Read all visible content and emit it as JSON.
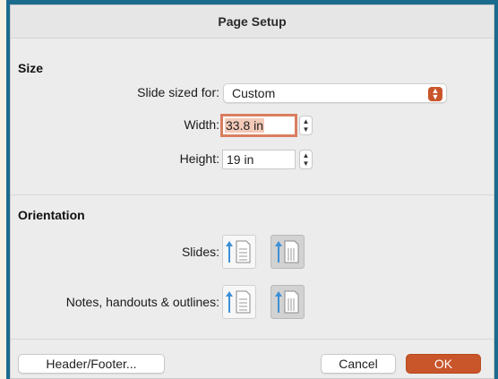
{
  "dialog": {
    "title": "Page Setup"
  },
  "size": {
    "heading": "Size",
    "slide_sized_for_label": "Slide sized for:",
    "slide_sized_for_value": "Custom",
    "width_label": "Width:",
    "width_value": "33.8 in",
    "height_label": "Height:",
    "height_value": "19 in"
  },
  "orientation": {
    "heading": "Orientation",
    "slides_label": "Slides:",
    "notes_label": "Notes, handouts & outlines:"
  },
  "footer": {
    "header_footer_label": "Header/Footer...",
    "cancel_label": "Cancel",
    "ok_label": "OK"
  },
  "colors": {
    "accent": "#c9552a",
    "arrow": "#3d8fd6",
    "frame": "#1b6b8f"
  },
  "icons": {
    "popup": "chevron-up-down-icon",
    "stepper": "stepper-icon",
    "portrait": "portrait-orientation-icon",
    "landscape": "landscape-orientation-icon"
  }
}
